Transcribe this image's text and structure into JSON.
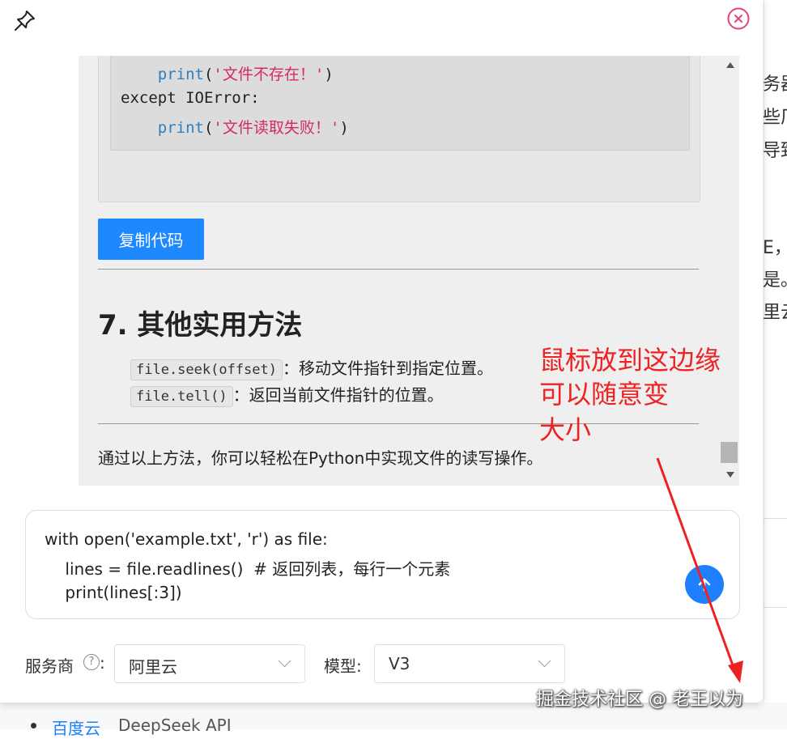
{
  "background": {
    "right_snippets": [
      "务器",
      "些厂",
      "导致",
      "E，",
      "是。",
      "里云"
    ],
    "bottom_link": "百度云",
    "bottom_text": "DeepSeek API"
  },
  "panel": {
    "pin_icon": "pin-icon",
    "close_icon": "close-circle-icon",
    "accent": "#e0457b"
  },
  "answer": {
    "code_lines": [
      {
        "indent": "    ",
        "fn": "",
        "str": "",
        "text": "p"
      },
      {
        "indent": "    ",
        "fn": "print",
        "str": "'文件不存在！'",
        "text": ""
      },
      {
        "indent": "",
        "fn": "",
        "str": "",
        "text": "except IOError:"
      },
      {
        "indent": "    ",
        "fn": "print",
        "str": "'文件读取失败！'",
        "text": ""
      }
    ],
    "copy_button": "复制代码",
    "heading": "7. 其他实用方法",
    "methods": [
      {
        "code": "file.seek(offset)",
        "desc": "：移动文件指针到指定位置。"
      },
      {
        "code": "file.tell()",
        "desc": "：返回当前文件指针的位置。"
      }
    ],
    "summary": "通过以上方法，你可以轻松在Python中实现文件的读写操作。"
  },
  "annotation": {
    "lines": [
      "鼠标放到这边缘",
      "可以随意变",
      "大小"
    ],
    "color": "#ee2222"
  },
  "input": {
    "lines": [
      "with open('example.txt', 'r') as file:",
      "    lines = file.readlines()  # 返回列表，每行一个元素",
      "    print(lines[:3])"
    ],
    "send_icon": "arrow-up-icon"
  },
  "controls": {
    "provider_label": "服务商",
    "help_icon": "question-circle-icon",
    "provider_value": "阿里云",
    "model_label": "模型:",
    "model_value": "V3"
  },
  "watermark": "掘金技术社区 @ 老王以为",
  "colors": {
    "primary": "#1e88ff",
    "send": "#1e80ff"
  }
}
